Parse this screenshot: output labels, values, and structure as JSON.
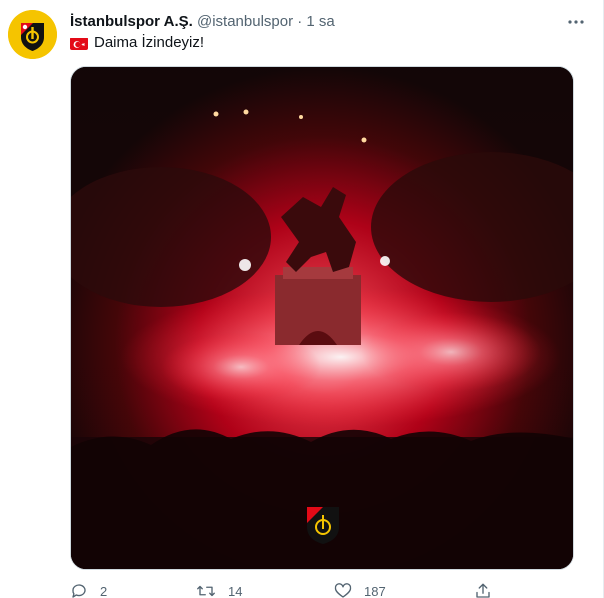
{
  "tweet": {
    "display_name": "İstanbulspor A.Ş.",
    "handle": "@istanbulspor",
    "separator": "·",
    "time": "1 sa",
    "text": "Daima İzindeyiz!",
    "flag_icon": "turkey-flag-icon"
  },
  "actions": {
    "reply_count": "2",
    "retweet_count": "14",
    "like_count": "187"
  },
  "colors": {
    "accent_yellow": "#f5c400",
    "flare_red": "#ff1a2e",
    "text_primary": "#0f1419",
    "text_secondary": "#536471"
  }
}
